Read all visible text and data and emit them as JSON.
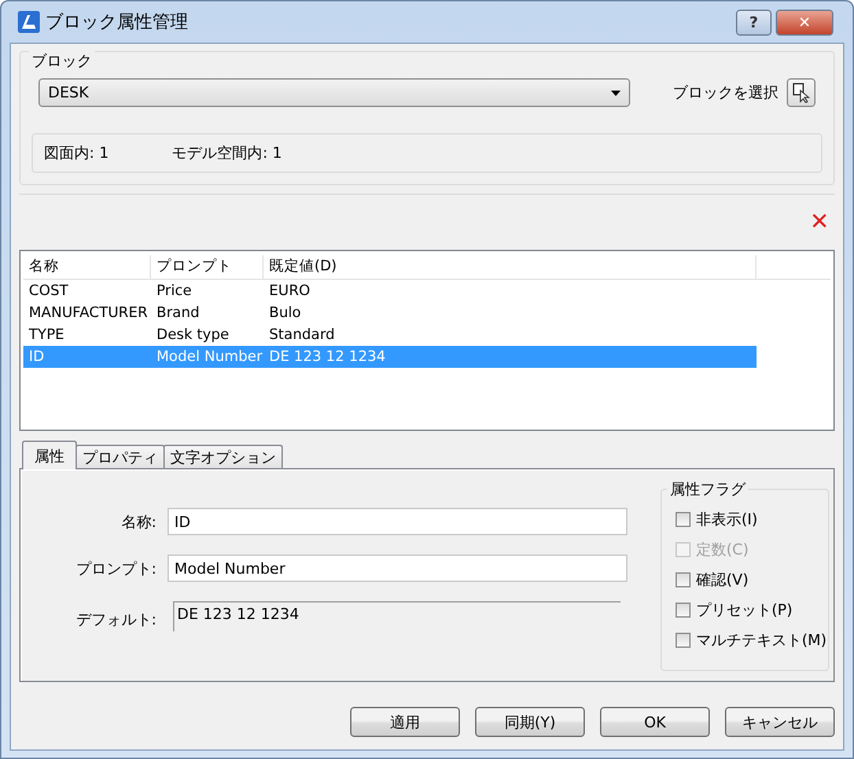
{
  "window": {
    "title": "ブロック属性管理",
    "buttons": [
      "?",
      "✕"
    ]
  },
  "block": {
    "legend": "ブロック",
    "value": "DESK",
    "select_label": "ブロックを選択",
    "counts": [
      "図面内: 1",
      "モデル空間内: 1"
    ]
  },
  "delete_icon": "✕",
  "table": {
    "columns": [
      "名称",
      "プロンプト",
      "既定値(D)"
    ],
    "rows": [
      {
        "cells": [
          "COST",
          "Price",
          "EURO"
        ],
        "selected": false
      },
      {
        "cells": [
          "MANUFACTURER",
          "Brand",
          "Bulo"
        ],
        "selected": false
      },
      {
        "cells": [
          "TYPE",
          "Desk type",
          "Standard"
        ],
        "selected": false
      },
      {
        "cells": [
          "ID",
          "Model Number",
          "DE 123 12 1234"
        ],
        "selected": true
      }
    ]
  },
  "tabs": [
    {
      "label": "属性",
      "selected": true
    },
    {
      "label": "プロパティ",
      "selected": false
    },
    {
      "label": "文字オプション",
      "selected": false
    }
  ],
  "fields": [
    {
      "label": "名称:",
      "value": "ID",
      "kind": "line"
    },
    {
      "label": "プロンプト:",
      "value": "Model Number",
      "kind": "line"
    },
    {
      "label": "デフォルト:",
      "value": "DE 123 12 1234",
      "kind": "multi"
    }
  ],
  "flags": {
    "legend": "属性フラグ",
    "items": [
      {
        "label": "非表示(I)",
        "checked": false,
        "disabled": false
      },
      {
        "label": "定数(C)",
        "checked": false,
        "disabled": true
      },
      {
        "label": "確認(V)",
        "checked": false,
        "disabled": false
      },
      {
        "label": "プリセット(P)",
        "checked": false,
        "disabled": false
      },
      {
        "label": "マルチテキスト(M)",
        "checked": false,
        "disabled": false
      }
    ]
  },
  "buttons": [
    "適用",
    "同期(Y)",
    "OK",
    "キャンセル"
  ]
}
